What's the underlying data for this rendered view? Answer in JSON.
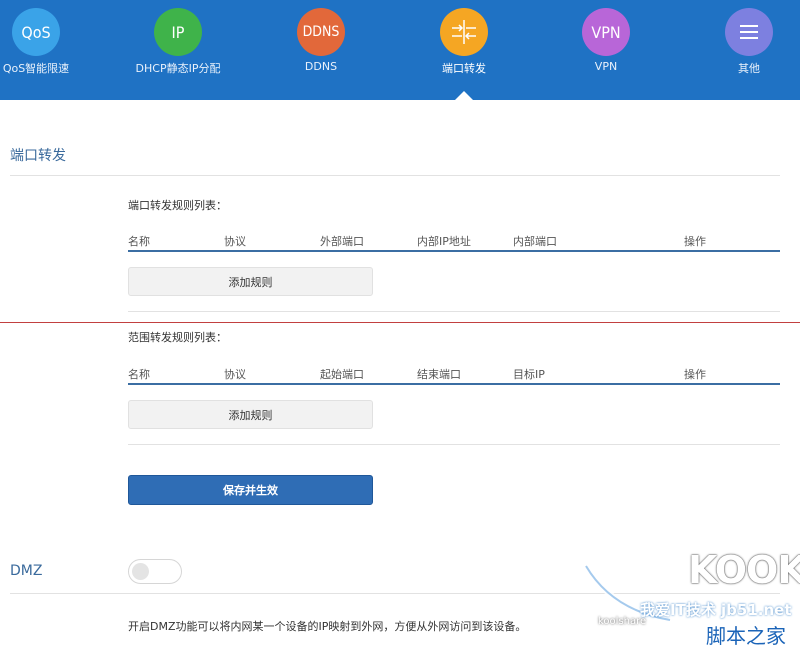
{
  "nav": {
    "items": [
      {
        "icon": "QoS",
        "label": "QoS智能限速",
        "color": "#3aa3e8"
      },
      {
        "icon": "IP",
        "label": "DHCP静态IP分配",
        "color": "#3fb34a"
      },
      {
        "icon": "DDNS",
        "label": "DDNS",
        "color": "#e2683a"
      },
      {
        "icon": "port-forward-icon",
        "label": "端口转发",
        "color": "#f5a623",
        "active": true
      },
      {
        "icon": "VPN",
        "label": "VPN",
        "color": "#b866d8"
      },
      {
        "icon": "menu-icon",
        "label": "其他",
        "color": "#7d80e0"
      }
    ]
  },
  "port_forward": {
    "title": "端口转发",
    "list_title": "端口转发规则列表：",
    "columns": [
      "名称",
      "协议",
      "外部端口",
      "内部IP地址",
      "内部端口",
      "操作"
    ],
    "add_label": "添加规则"
  },
  "range_forward": {
    "list_title": "范围转发规则列表：",
    "columns": [
      "名称",
      "协议",
      "起始端口",
      "结束端口",
      "目标IP",
      "操作"
    ],
    "add_label": "添加规则"
  },
  "save_label": "保存并生效",
  "dmz": {
    "title": "DMZ",
    "enabled": false,
    "description": "开启DMZ功能可以将内网某一个设备的IP映射到外网，方便从外网访问到该设备。"
  },
  "watermark": {
    "brand": "KOOK",
    "line1": "我爱IT技术 jb51.net",
    "line2": "koolshare",
    "line3": "脚本之家"
  }
}
